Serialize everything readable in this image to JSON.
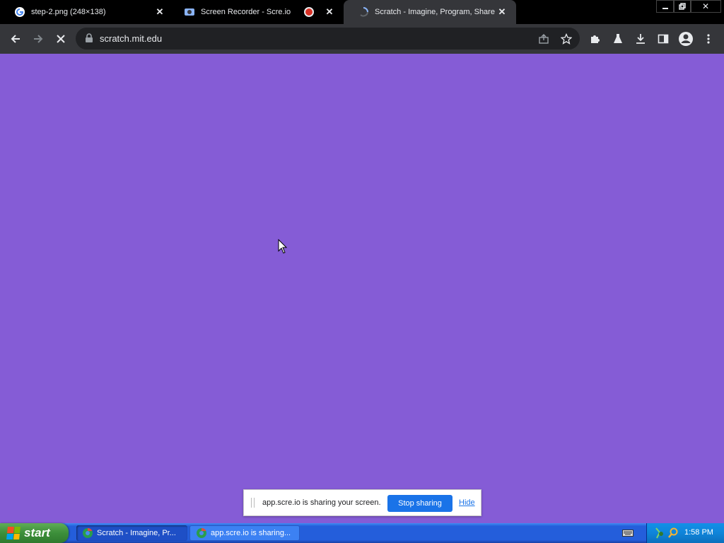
{
  "browser": {
    "tabs": [
      {
        "title": "step-2.png (248×138)",
        "icon": "google-g-icon",
        "active": false
      },
      {
        "title": "Screen Recorder - Scre.io",
        "icon": "screen-recorder-icon",
        "active": false,
        "recording": true
      },
      {
        "title": "Scratch - Imagine, Program, Share",
        "icon": "scratch-icon",
        "active": true
      }
    ],
    "url": "scratch.mit.edu",
    "loading": true
  },
  "page": {
    "background": "#855cd6"
  },
  "share_bar": {
    "message": "app.scre.io is sharing your screen.",
    "stop_label": "Stop sharing",
    "hide_label": "Hide"
  },
  "taskbar": {
    "start_label": "start",
    "tasks": [
      {
        "label": "Scratch - Imagine, Pr...",
        "active": true
      },
      {
        "label": "app.scre.io is sharing...",
        "active": false
      }
    ],
    "clock": "1:58 PM"
  },
  "colors": {
    "accent": "#1a73e8",
    "xp_taskbar": "#245edb",
    "start_green": "#3c8f3a"
  }
}
